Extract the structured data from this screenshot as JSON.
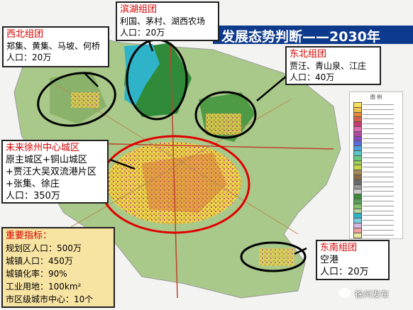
{
  "title": "发展态势判断——2030年",
  "groups": {
    "northwest": {
      "name": "西北组团",
      "places": "郑集、黄集、马坡、何桥",
      "population": "人口：20万"
    },
    "binhu": {
      "name": "滨湖组团",
      "places": "利国、茅村、湖西农场",
      "population": "人口：20万"
    },
    "northeast": {
      "name": "东北组团",
      "places": "贾汪、青山泉、江庄",
      "population": "人口：40万"
    },
    "center": {
      "name": "未来徐州中心城区",
      "lines": [
        "原主城区+铜山城区",
        "+贾汪大吴双流港片区",
        "+张集、徐庄"
      ],
      "population": "人口：350万"
    },
    "southeast": {
      "name": "东南组团",
      "places": "空港",
      "population": "人口：20万"
    }
  },
  "indicators": {
    "heading": "重要指标：",
    "items": [
      "规划区人口：500万",
      "城镇人口：450万",
      "城镇化率：90%",
      "工业用地：100km²",
      "市区级城市中心：10个"
    ]
  },
  "legend": {
    "title": "图 例"
  },
  "watermark": "徐州发布",
  "colors": {
    "title_bg": "#0d3a8c",
    "heading_red": "#d40000",
    "ellipse": "#000000",
    "center_ellipse": "#e00000",
    "indicator_bg": "#f7e3a2"
  }
}
